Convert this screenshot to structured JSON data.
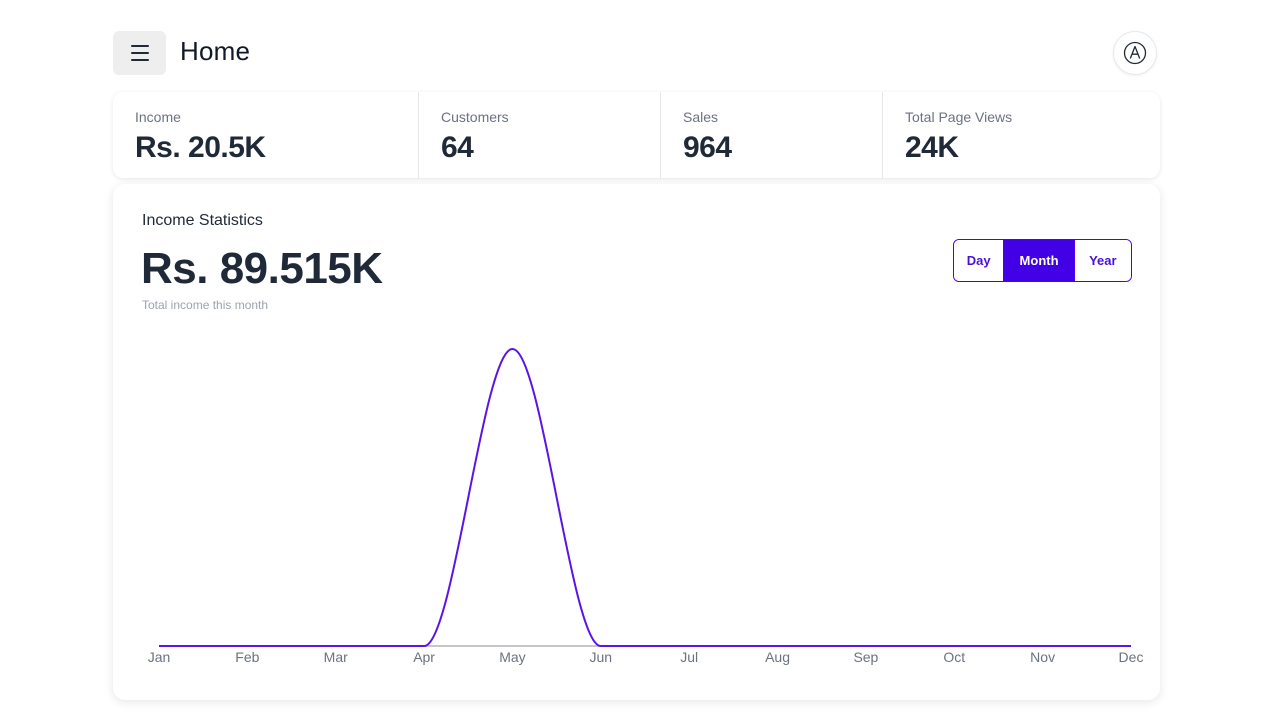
{
  "header": {
    "title": "Home",
    "menu_icon": "hamburger-menu-icon",
    "avatar_icon": "circled-a-icon",
    "avatar_glyph": "Ⓐ"
  },
  "stats": [
    {
      "label": "Income",
      "value": "Rs. 20.5K"
    },
    {
      "label": "Customers",
      "value": "64"
    },
    {
      "label": "Sales",
      "value": "964"
    },
    {
      "label": "Total Page Views",
      "value": "24K"
    }
  ],
  "income": {
    "title": "Income Statistics",
    "value": "Rs. 89.515K",
    "subtitle": "Total income this month",
    "periods": [
      "Day",
      "Month",
      "Year"
    ],
    "active_period": "Month"
  },
  "colors": {
    "accent": "#4200e6",
    "line": "#5b14e8",
    "axis": "#c7c7c7",
    "text_dark": "#1f2937",
    "text_muted": "#6b7280"
  },
  "chart_data": {
    "type": "line",
    "categories": [
      "Jan",
      "Feb",
      "Mar",
      "Apr",
      "May",
      "Jun",
      "Jul",
      "Aug",
      "Sep",
      "Oct",
      "Nov",
      "Dec"
    ],
    "series": [
      {
        "values": [
          0,
          0,
          0,
          0,
          89515,
          0,
          0,
          0,
          0,
          0,
          0,
          0
        ]
      }
    ],
    "ylim": [
      0,
      89515
    ],
    "grid": false,
    "curve": "smooth"
  }
}
